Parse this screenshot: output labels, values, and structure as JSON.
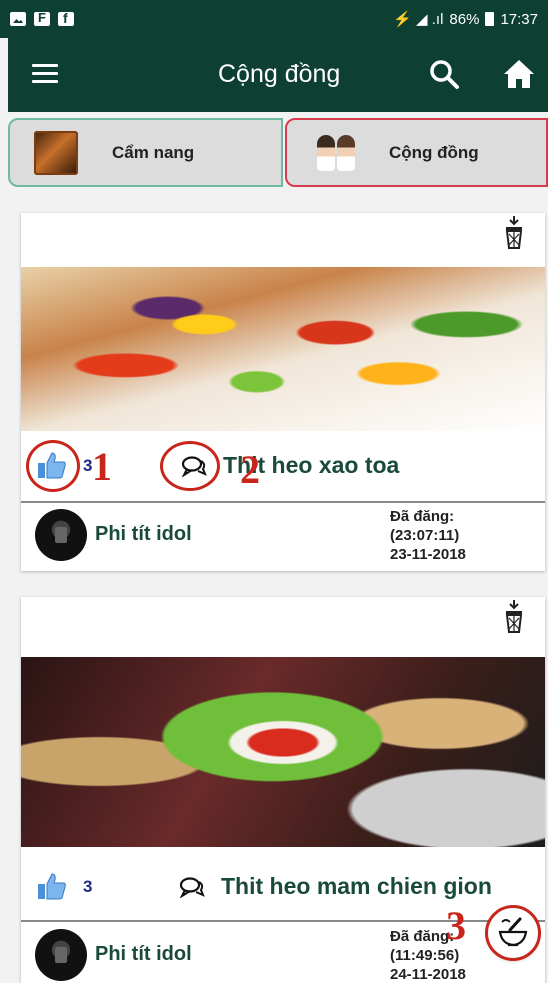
{
  "status_bar": {
    "left_icons": [
      "photo-icon",
      "flipboard-icon",
      "facebook-icon"
    ],
    "signal_text": "⚡ ◢ .ıl",
    "battery": "86%",
    "time": "17:37"
  },
  "app_bar": {
    "title": "Cộng đồng",
    "icons": [
      "menu-icon",
      "search-icon",
      "home-icon"
    ]
  },
  "tabs": [
    {
      "label": "Cẩm nang",
      "active": false
    },
    {
      "label": "Cộng đồng",
      "active": true
    }
  ],
  "posts": [
    {
      "likes": "3",
      "title": "Thit heo xao toa",
      "author": "Phi tít idol",
      "posted_label": "Đã đăng:",
      "posted_time": "(23:07:11)",
      "posted_date": "23-11-2018"
    },
    {
      "likes": "3",
      "title": "Thit heo mam chien gion",
      "author": "Phi tít idol",
      "posted_label": "Đã đăng:",
      "posted_time": "(11:49:56)",
      "posted_date": "24-11-2018"
    }
  ],
  "annotations": [
    "1",
    "2",
    "3"
  ],
  "colors": {
    "app_bar": "#0d3f33",
    "title_text": "#1a4a3a",
    "like_count": "#1e2a8a",
    "annotation": "#c8261b",
    "active_tab_border": "#d83b4b",
    "inactive_tab_border": "#6fb8a3"
  }
}
